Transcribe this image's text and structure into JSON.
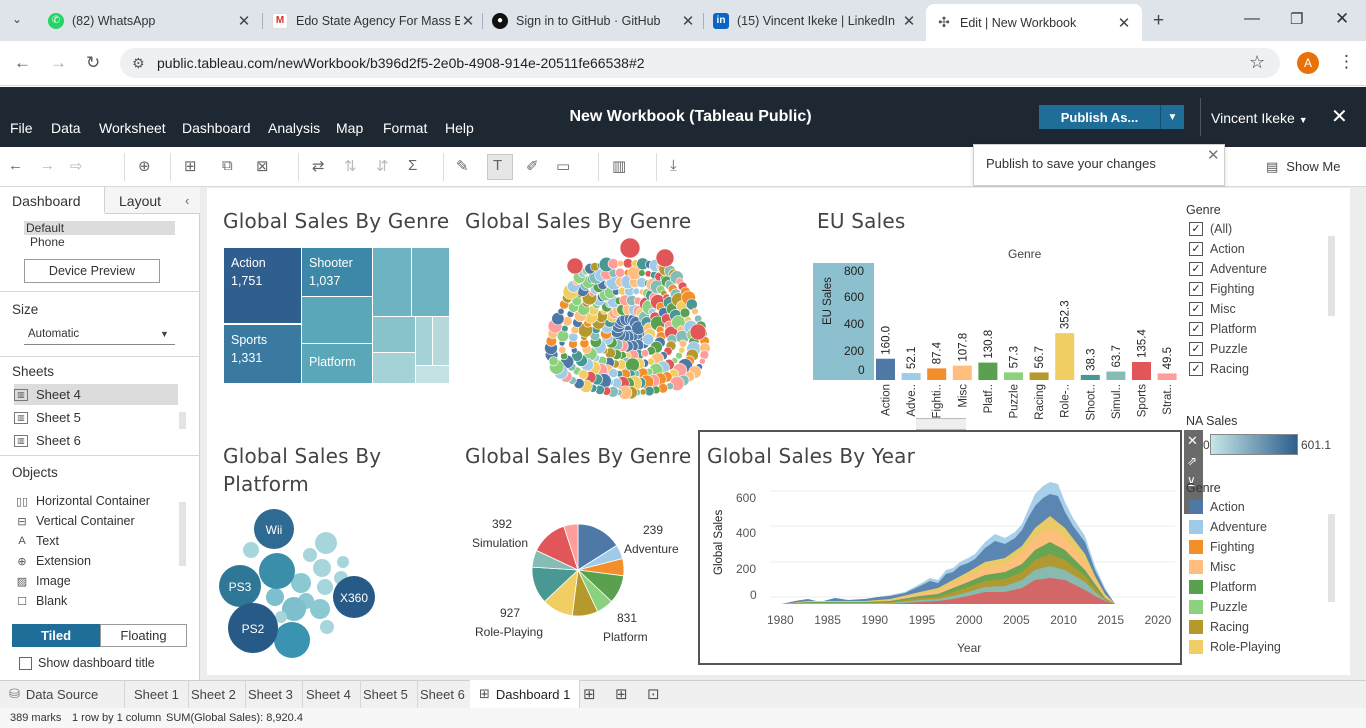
{
  "browser": {
    "tabs": [
      {
        "title": "(82) WhatsApp",
        "icon": "whatsapp-icon"
      },
      {
        "title": "Edo State Agency For Mass E",
        "icon": "gmail-icon"
      },
      {
        "title": "Sign in to GitHub · GitHub",
        "icon": "github-icon"
      },
      {
        "title": "(15) Vincent Ikeke | LinkedIn",
        "icon": "linkedin-icon"
      },
      {
        "title": "Edit | New Workbook",
        "icon": "tableau-icon"
      }
    ],
    "url": "public.tableau.com/newWorkbook/b396d2f5-2e0b-4908-914e-20511fe66538#2",
    "profile_initial": "A"
  },
  "app": {
    "menu": [
      "File",
      "Data",
      "Worksheet",
      "Dashboard",
      "Analysis",
      "Map",
      "Format",
      "Help"
    ],
    "title": "New Workbook (Tableau Public)",
    "publish_label": "Publish As...",
    "user": "Vincent Ikeke",
    "tooltip": "Publish to save your changes",
    "show_me": "Show Me"
  },
  "left": {
    "tabs": [
      "Dashboard",
      "Layout"
    ],
    "device_default": "Default",
    "device_phone": "Phone",
    "device_preview": "Device Preview",
    "size_head": "Size",
    "size_value": "Automatic",
    "sheets_head": "Sheets",
    "sheets": [
      "Sheet 4",
      "Sheet 5",
      "Sheet 6"
    ],
    "objects_head": "Objects",
    "objects": [
      "Horizontal Container",
      "Vertical Container",
      "Text",
      "Extension",
      "Image",
      "Blank"
    ],
    "tiled": "Tiled",
    "floating": "Floating",
    "show_title": "Show dashboard title"
  },
  "dashboard": {
    "treemap": {
      "title": "Global Sales By Genre",
      "cells": [
        {
          "label": "Action",
          "value": "1,751",
          "color": "#2f5f8f"
        },
        {
          "label": "Shooter",
          "value": "1,037",
          "color": "#3d88a8"
        },
        {
          "label": "Sports",
          "value": "1,331",
          "color": "#3a7aa0"
        },
        {
          "label": "Platform",
          "value": "",
          "color": "#5aa7ba"
        }
      ]
    },
    "bubble_genre": {
      "title": "Global Sales  By Genre"
    },
    "eu_sales": {
      "title": "EU Sales",
      "header": "Genre",
      "ylabel": "EU Sales",
      "yticks": [
        "800",
        "600",
        "400",
        "200",
        "0"
      ]
    },
    "platform": {
      "title_line1": "Global Sales By",
      "title_line2": "Platform",
      "labels": [
        "Wii",
        "PS3",
        "X360",
        "PS2"
      ]
    },
    "pie": {
      "title": "Global Sales By Genre",
      "labels": [
        {
          "value": "392",
          "name": "Simulation"
        },
        {
          "value": "239",
          "name": "Adventure"
        },
        {
          "value": "927",
          "name": "Role-Playing"
        },
        {
          "value": "831",
          "name": "Platform"
        }
      ]
    },
    "area": {
      "title": "Global Sales By Year",
      "ylabel": "Global Sales",
      "xlabel": "Year",
      "yticks": [
        "600",
        "400",
        "200",
        "0"
      ],
      "xticks": [
        "1980",
        "1985",
        "1990",
        "1995",
        "2000",
        "2005",
        "2010",
        "2015",
        "2020"
      ]
    },
    "genre_filter": {
      "title": "Genre",
      "items": [
        "(All)",
        "Action",
        "Adventure",
        "Fighting",
        "Misc",
        "Platform",
        "Puzzle",
        "Racing"
      ]
    },
    "na_sales": {
      "title": "NA Sales",
      "min": "0",
      "max": "601.1"
    },
    "genre_legend": {
      "title": "Genre",
      "items": [
        {
          "name": "Action",
          "color": "#4e79a7"
        },
        {
          "name": "Adventure",
          "color": "#a0cbe8"
        },
        {
          "name": "Fighting",
          "color": "#f28e2b"
        },
        {
          "name": "Misc",
          "color": "#ffbe7d"
        },
        {
          "name": "Platform",
          "color": "#59a14f"
        },
        {
          "name": "Puzzle",
          "color": "#8cd17d"
        },
        {
          "name": "Racing",
          "color": "#b6992d"
        },
        {
          "name": "Role-Playing",
          "color": "#f1ce63"
        }
      ]
    }
  },
  "chart_data": [
    {
      "type": "bar",
      "title": "EU Sales",
      "xlabel": "Genre",
      "ylabel": "EU Sales",
      "ylim": [
        0,
        800
      ],
      "categories": [
        "Action",
        "Adve..",
        "Fighti..",
        "Misc",
        "Platf..",
        "Puzzle",
        "Racing",
        "Role-..",
        "Shoot..",
        "Simul..",
        "Sports",
        "Strat.."
      ],
      "values": [
        160.0,
        52.1,
        87.4,
        107.8,
        130.8,
        57.3,
        56.7,
        352.3,
        38.3,
        63.7,
        135.4,
        49.5
      ],
      "colors": [
        "#4e79a7",
        "#a0cbe8",
        "#f28e2b",
        "#ffbe7d",
        "#59a14f",
        "#8cd17d",
        "#b6992d",
        "#f1ce63",
        "#499894",
        "#86bcb6",
        "#e15759",
        "#ff9d9a"
      ]
    }
  ],
  "bottom": {
    "data_source": "Data Source",
    "tabs": [
      "Sheet 1",
      "Sheet 2",
      "Sheet 3",
      "Sheet 4",
      "Sheet 5",
      "Sheet 6",
      "Dashboard 1"
    ],
    "marks": "389 marks",
    "rows": "1 row by 1 column",
    "sum": "SUM(Global Sales): 8,920.4"
  }
}
